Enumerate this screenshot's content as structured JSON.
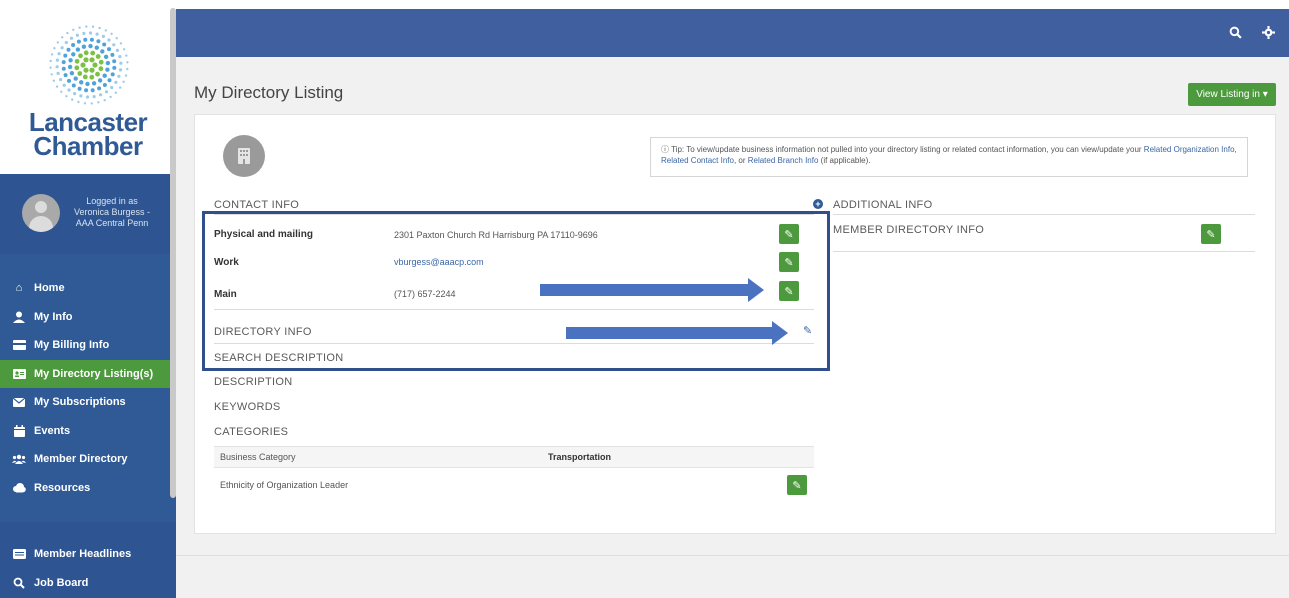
{
  "brand": {
    "name_line1": "Lancaster",
    "name_line2": "Chamber",
    "colors": {
      "sidebar": "#2f5a96",
      "accent_green": "#4c9a3d",
      "topbar": "#3f5f9f"
    }
  },
  "user": {
    "logged_in_label": "Logged in as",
    "name": "Veronica Burgess -",
    "org": "AAA Central Penn"
  },
  "sidebar": {
    "items": [
      {
        "label": "Home",
        "icon": "home-icon"
      },
      {
        "label": "My Info",
        "icon": "person-icon"
      },
      {
        "label": "My Billing Info",
        "icon": "credit-card-icon"
      },
      {
        "label": "My Directory Listing(s)",
        "icon": "id-card-icon",
        "active": true
      },
      {
        "label": "My Subscriptions",
        "icon": "envelope-icon"
      },
      {
        "label": "Events",
        "icon": "calendar-icon"
      },
      {
        "label": "Member Directory",
        "icon": "users-icon"
      },
      {
        "label": "Resources",
        "icon": "cloud-icon"
      }
    ],
    "bottom_items": [
      {
        "label": "Member Headlines",
        "icon": "newspaper-icon"
      },
      {
        "label": "Job Board",
        "icon": "search-icon"
      }
    ]
  },
  "topbar": {
    "search_icon": "search-icon",
    "settings_icon": "gear-icon"
  },
  "page": {
    "title": "My Directory Listing",
    "view_listing_button": "View Listing in ▾"
  },
  "tip": {
    "prefix": "ⓘ Tip: To view/update business information not pulled into your directory listing or related contact information, you can view/update your",
    "link1": "Related Organization Info",
    "sep1": ", ",
    "link2": "Related Contact Info",
    "sep2": ", or ",
    "link3": "Related Branch Info",
    "suffix": " (if applicable)."
  },
  "contact": {
    "section_title": "CONTACT INFO",
    "rows": [
      {
        "label": "Physical and mailing",
        "value": "2301 Paxton Church Rd Harrisburg PA 17110-9696"
      },
      {
        "label": "Work",
        "value": "vburgess@aaacp.com"
      },
      {
        "label": "Main",
        "value": "(717) 657-2244"
      }
    ]
  },
  "directory": {
    "directory_info": "DIRECTORY INFO",
    "search_description": "SEARCH DESCRIPTION",
    "description": "DESCRIPTION",
    "keywords": "KEYWORDS",
    "categories": "CATEGORIES",
    "category_rows": [
      {
        "label": "Business Category",
        "value": "Transportation"
      },
      {
        "label": "Ethnicity of Organization Leader",
        "value": ""
      }
    ]
  },
  "additional": {
    "section_title": "ADDITIONAL INFO",
    "member_directory_info": "MEMBER DIRECTORY INFO"
  }
}
